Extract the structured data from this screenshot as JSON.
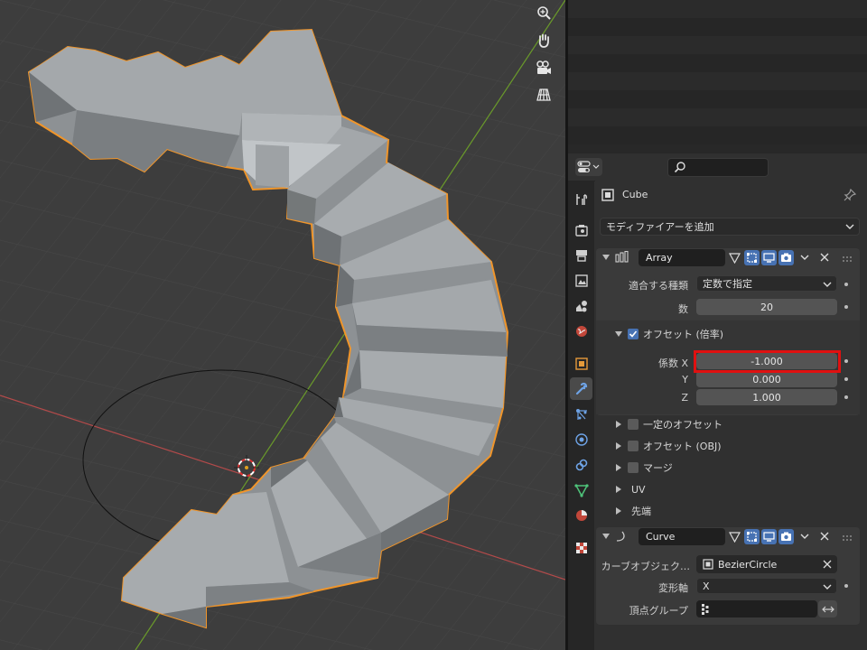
{
  "outliner": {
    "rows": 8
  },
  "viewport": {
    "nav_icons": [
      "zoom-icon",
      "hand-pan-icon",
      "camera-icon",
      "perspective-grid-icon"
    ]
  },
  "properties": {
    "search_placeholder": "",
    "object_name": "Cube",
    "add_modifier_label": "モディファイアーを追加",
    "array": {
      "name": "Array",
      "fit_type_label": "適合する種類",
      "fit_type_value": "定数で指定",
      "count_label": "数",
      "count_value": "20",
      "relative_offset_label": "オフセット (倍率)",
      "factor_x_label": "係数 X",
      "factor_x_value": "-1.000",
      "factor_y_label": "Y",
      "factor_y_value": "0.000",
      "factor_z_label": "Z",
      "factor_z_value": "1.000",
      "constant_offset_label": "一定のオフセット",
      "object_offset_label": "オフセット (OBJ)",
      "merge_label": "マージ",
      "uv_label": "UV",
      "caps_label": "先端"
    },
    "curve": {
      "name": "Curve",
      "curve_object_label": "カーブオブジェク…",
      "curve_object_value": "BezierCircle",
      "deform_axis_label": "変形軸",
      "deform_axis_value": "X",
      "vertex_group_label": "頂点グループ",
      "vertex_group_value": ""
    }
  },
  "colors": {
    "selection_outline": "#f0952a",
    "highlight_box": "#e01010",
    "active_blue": "#4772b3",
    "x_axis": "#b34a4a",
    "y_axis": "#6a9a2a"
  }
}
